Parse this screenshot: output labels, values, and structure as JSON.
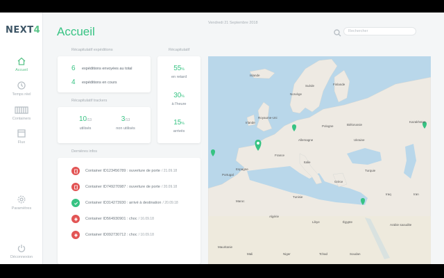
{
  "logo": {
    "prefix": "NEXT",
    "suffix": "4"
  },
  "nav": [
    {
      "label": "Accueil",
      "icon": "home-icon",
      "active": true
    },
    {
      "label": "Temps réel",
      "icon": "clock-icon",
      "active": false
    },
    {
      "label": "Containers",
      "icon": "container-icon",
      "active": false
    },
    {
      "label": "Flux",
      "icon": "flux-icon",
      "active": false
    },
    {
      "label": "Paramètres",
      "icon": "gear-icon",
      "active": false
    },
    {
      "label": "Déconnexion",
      "icon": "power-icon",
      "active": false
    }
  ],
  "header": {
    "title": "Accueil",
    "date": "Vendredi 21 Septembre 2018",
    "search_placeholder": "Rechercher"
  },
  "shipments": {
    "label": "Récapitulatif expéditions",
    "rows": [
      {
        "value": "6",
        "text": "expéditions envoyées au total"
      },
      {
        "value": "4",
        "text": "expéditions en cours"
      }
    ]
  },
  "trackers": {
    "label": "Récapitulatif trackers",
    "used": {
      "value": "10",
      "total": "/13",
      "text": "utilisés"
    },
    "unused": {
      "value": "3",
      "total": "/13",
      "text": "non utilisés"
    }
  },
  "summary": {
    "label": "Récapitulatif",
    "stats": [
      {
        "value": "55",
        "unit": "%",
        "text": "en retard"
      },
      {
        "value": "30",
        "unit": "%",
        "text": "à l'heure"
      },
      {
        "value": "15",
        "unit": "%",
        "text": "arrivés"
      }
    ]
  },
  "info": {
    "label": "Dernières infos",
    "items": [
      {
        "type": "alert",
        "icon": "door-icon",
        "color": "#e25454",
        "text": "Container ID123456789 : ouverture de porte",
        "date": "/ 21.09.18"
      },
      {
        "type": "alert",
        "icon": "door-icon",
        "color": "#e25454",
        "text": "Container ID749270987 : ouverture de porte",
        "date": "/ 20.09.18"
      },
      {
        "type": "ok",
        "icon": "check-icon",
        "color": "#37c383",
        "text": "Container ID314273930 : arrivé à destination",
        "date": "/ 20.09.18"
      },
      {
        "type": "alert",
        "icon": "shock-icon",
        "color": "#e25454",
        "text": "Container ID564930901 : choc",
        "date": "/ 16.09.18"
      },
      {
        "type": "alert",
        "icon": "shock-icon",
        "color": "#e25454",
        "text": "Container ID092730712 : choc",
        "date": "/ 10.09.18"
      }
    ]
  },
  "map": {
    "labels": [
      "Islande",
      "Suède",
      "Finlande",
      "Norvège",
      "Irlande",
      "Royaume-Uni",
      "Allemagne",
      "Pologne",
      "Biélorussie",
      "Ukraine",
      "France",
      "Kazakhstan",
      "Espagne",
      "Portugal",
      "Italie",
      "Turquie",
      "Grèce",
      "Tunisie",
      "Maroc",
      "Algérie",
      "Libye",
      "Égypte",
      "Iraq",
      "Iran",
      "Arabie saoudite",
      "Mauritanie",
      "Mali",
      "Niger",
      "Tchad",
      "Soudan"
    ],
    "marker_color": "#37c383"
  }
}
